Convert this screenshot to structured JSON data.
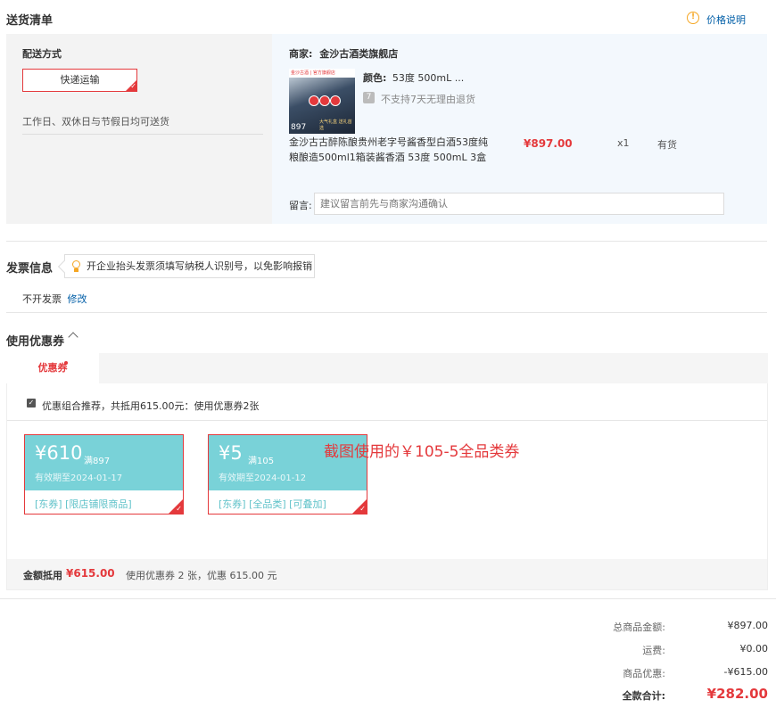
{
  "delivery": {
    "title": "送货清单",
    "price_note": "价格说明",
    "method_label": "配送方式",
    "method_button": "快递运输",
    "method_desc": "工作日、双休日与节假日均可送货",
    "merchant_label": "商家:",
    "merchant_name": "金沙古酒类旗舰店",
    "image": {
      "top_text": "金沙古酒 | 官方旗舰店",
      "price_text": "897",
      "caption": "大气礼盒 送礼首选"
    },
    "color_label": "颜色:",
    "color_value": "53度 500mL ...",
    "no_return_icon": "7",
    "no_return": "不支持7天无理由退货",
    "product_name": "金沙古古醉陈酿贵州老字号酱香型白酒53度纯粮酿造500ml1箱装酱香酒 53度 500mL 3盒",
    "price": "¥897.00",
    "qty": "x1",
    "stock": "有货",
    "memo_label": "留言:",
    "memo_placeholder": "建议留言前先与商家沟通确认"
  },
  "invoice": {
    "title": "发票信息",
    "tip": "开企业抬头发票须填写纳税人识别号，以免影响报销",
    "status": "不开发票",
    "edit": "修改"
  },
  "coupons": {
    "title": "使用优惠券",
    "tab": "优惠券",
    "combo_text": "优惠组合推荐，共抵用615.00元：使用优惠券2张",
    "items": [
      {
        "amount": "¥610",
        "condition": "满897",
        "expiry": "有效期至2024-01-17",
        "tags": "[东券]  [限店铺限商品]"
      },
      {
        "amount": "¥5",
        "condition": "满105",
        "expiry": "有效期至2024-01-12",
        "tags": "[东券]  [全品类]  [可叠加]"
      }
    ],
    "annotation": "截图使用的￥105-5全品类券",
    "footer_label": "金额抵用",
    "footer_amount": "¥615.00",
    "footer_desc": "使用优惠券 2 张，优惠 615.00 元"
  },
  "totals": {
    "goods_label": "总商品金额:",
    "goods_value": "¥897.00",
    "freight_label": "运费:",
    "freight_value": "¥0.00",
    "discount_label": "商品优惠:",
    "discount_value": "-¥615.00",
    "total_label": "全款合计:",
    "total_value": "¥282.00"
  },
  "colors": {
    "accent": "#e4393c",
    "coupon": "#79d2d8",
    "link": "#005ea7"
  }
}
